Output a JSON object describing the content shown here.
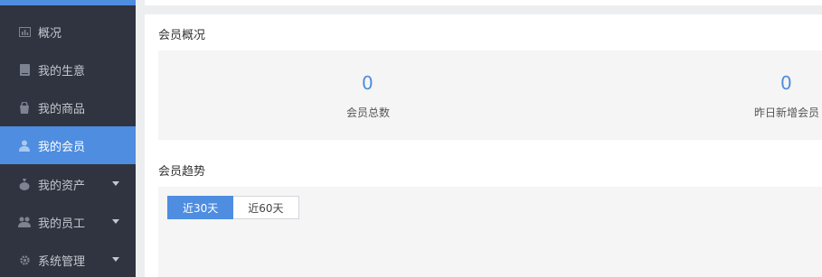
{
  "sidebar": {
    "items": [
      {
        "label": "概况",
        "icon": "chart-icon",
        "active": false,
        "has_caret": false
      },
      {
        "label": "我的生意",
        "icon": "book-icon",
        "active": false,
        "has_caret": false
      },
      {
        "label": "我的商品",
        "icon": "bag-icon",
        "active": false,
        "has_caret": false
      },
      {
        "label": "我的会员",
        "icon": "user-icon",
        "active": true,
        "has_caret": false
      },
      {
        "label": "我的资产",
        "icon": "money-bag-icon",
        "active": false,
        "has_caret": true
      },
      {
        "label": "我的员工",
        "icon": "group-icon",
        "active": false,
        "has_caret": true
      },
      {
        "label": "系统管理",
        "icon": "gear-icon",
        "active": false,
        "has_caret": true
      }
    ]
  },
  "overview": {
    "title": "会员概况",
    "stats": [
      {
        "value": "0",
        "label": "会员总数"
      },
      {
        "value": "0",
        "label": "昨日新增会员"
      }
    ]
  },
  "trend": {
    "title": "会员趋势",
    "tabs": [
      {
        "label": "近30天",
        "active": true
      },
      {
        "label": "近60天",
        "active": false
      }
    ]
  },
  "colors": {
    "accent": "#4e8de0",
    "sidebar_bg": "#2f3440",
    "sidebar_text": "#c3c7ce"
  }
}
